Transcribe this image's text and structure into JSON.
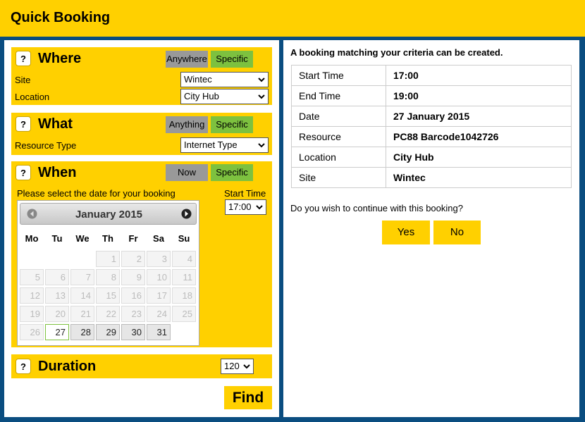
{
  "app": {
    "title": "Quick Booking"
  },
  "where": {
    "title": "Where",
    "help": "?",
    "toggle_a": "Anywhere",
    "toggle_b": "Specific",
    "site_label": "Site",
    "site_value": "Wintec",
    "location_label": "Location",
    "location_value": "City Hub"
  },
  "what": {
    "title": "What",
    "help": "?",
    "toggle_a": "Anything",
    "toggle_b": "Specific",
    "resource_label": "Resource Type",
    "resource_value": "Internet Type"
  },
  "when": {
    "title": "When",
    "help": "?",
    "toggle_a": "Now",
    "toggle_b": "Specific",
    "date_prompt": "Please select the date for your booking",
    "start_label": "Start Time",
    "start_value": "17:00",
    "calendar": {
      "month": "January 2015",
      "weekdays": [
        "Mo",
        "Tu",
        "We",
        "Th",
        "Fr",
        "Sa",
        "Su"
      ],
      "weeks": [
        [
          null,
          null,
          null,
          "1",
          "2",
          "3",
          "4"
        ],
        [
          "5",
          "6",
          "7",
          "8",
          "9",
          "10",
          "11"
        ],
        [
          "12",
          "13",
          "14",
          "15",
          "16",
          "17",
          "18"
        ],
        [
          "19",
          "20",
          "21",
          "22",
          "23",
          "24",
          "25"
        ],
        [
          "26",
          "27",
          "28",
          "29",
          "30",
          "31",
          null
        ]
      ],
      "selected_day": "27",
      "available_days": [
        "28",
        "29",
        "30",
        "31"
      ]
    }
  },
  "duration": {
    "title": "Duration",
    "help": "?",
    "value": "120"
  },
  "find_label": "Find",
  "result": {
    "message": "A booking matching your criteria can be created.",
    "rows": [
      {
        "label": "Start Time",
        "value": "17:00"
      },
      {
        "label": "End Time",
        "value": "19:00"
      },
      {
        "label": "Date",
        "value": "27 January 2015"
      },
      {
        "label": "Resource",
        "value": "PC88 Barcode1042726"
      },
      {
        "label": "Location",
        "value": "City Hub"
      },
      {
        "label": "Site",
        "value": "Wintec"
      }
    ],
    "question": "Do you wish to continue with this booking?",
    "yes_label": "Yes",
    "no_label": "No"
  },
  "colors": {
    "accent": "#ffd000",
    "frame": "#0a4d80",
    "selected_green": "#7dc13f",
    "inactive_grey": "#999999"
  },
  "icons": {
    "dropdown": "chevron-down-icon",
    "prev": "prev-month-icon",
    "next": "next-month-icon"
  }
}
